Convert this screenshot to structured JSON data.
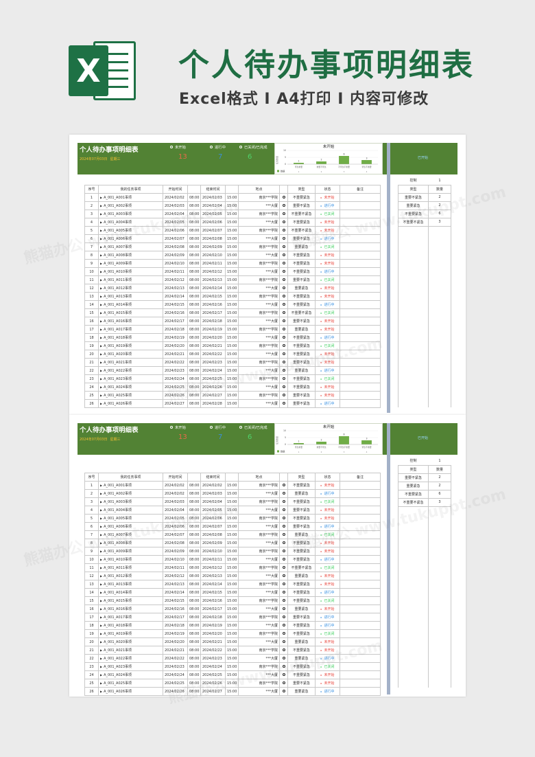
{
  "header": {
    "logo_letter": "X",
    "title": "个人待办事项明细表",
    "subtitle": "Excel格式 I A4打印 I 内容可修改"
  },
  "sheet": {
    "title": "个人待办事项明细表",
    "date": "2024年07月03日",
    "weekday": "星期三",
    "stats": [
      {
        "label": "未开始",
        "value": "13",
        "color": "#e86a4a"
      },
      {
        "label": "进行中",
        "value": "7",
        "color": "#3a8fd9"
      },
      {
        "label": "已关闭/已完成",
        "value": "6",
        "color": "#4fd36b"
      }
    ],
    "right_label": "已开始",
    "columns": [
      "序号",
      "我的任务事项",
      "开始时间",
      "",
      "结束时间",
      "",
      "地点",
      "",
      "类型",
      "状态",
      "备注"
    ]
  },
  "chart_data": {
    "type": "bar",
    "title": "未开始",
    "categories": [
      "紧急重要",
      "重要不紧急",
      "不紧急不重要",
      "紧急不重要"
    ],
    "values": [
      1,
      2,
      6,
      3
    ],
    "ylim": [
      0,
      10
    ],
    "ylabel": "任务数量",
    "y_ticks": [
      "10",
      "5",
      "0"
    ],
    "x_ticks": [
      "1",
      "2",
      "3",
      "4"
    ],
    "legend": "数据",
    "bar_color": "#70ad47"
  },
  "control": {
    "label": "控制",
    "value": "1",
    "headers": [
      "类型",
      "数量"
    ],
    "rows": [
      {
        "type": "重要不紧急",
        "count": "2"
      },
      {
        "type": "重要紧急",
        "count": "2"
      },
      {
        "type": "不重要紧急",
        "count": "6"
      },
      {
        "type": "不重要不紧急",
        "count": "3"
      }
    ]
  },
  "status_colors": {
    "未开始": "#e8453c",
    "进行中": "#2f8be0",
    "已关闭": "#3ccf5c"
  },
  "rows1": [
    {
      "n": "1",
      "t": "A_001_A001事项",
      "sd": "2024/02/02",
      "st": "08:00",
      "ed": "2024/02/03",
      "et": "15:00",
      "p": "南京***学院",
      "ty": "不重要紧急",
      "s": "未开始"
    },
    {
      "n": "2",
      "t": "A_001_A002事项",
      "sd": "2024/02/03",
      "st": "08:00",
      "ed": "2024/02/04",
      "et": "15:00",
      "p": "***大厦",
      "ty": "重要不紧急",
      "s": "进行中"
    },
    {
      "n": "3",
      "t": "A_001_A003事项",
      "sd": "2024/02/04",
      "st": "08:00",
      "ed": "2024/02/05",
      "et": "15:00",
      "p": "南京***学院",
      "ty": "不重要不紧急",
      "s": "已关闭"
    },
    {
      "n": "4",
      "t": "A_001_A004事项",
      "sd": "2024/02/05",
      "st": "08:00",
      "ed": "2024/02/06",
      "et": "15:00",
      "p": "***大厦",
      "ty": "不重要紧急",
      "s": "未开始"
    },
    {
      "n": "5",
      "t": "A_001_A005事项",
      "sd": "2024/02/06",
      "st": "08:00",
      "ed": "2024/02/07",
      "et": "15:00",
      "p": "南京***学院",
      "ty": "不重要不紧急",
      "s": "未开始"
    },
    {
      "n": "6",
      "t": "A_001_A006事项",
      "sd": "2024/02/07",
      "st": "08:00",
      "ed": "2024/02/08",
      "et": "15:00",
      "p": "***大厦",
      "ty": "重要不紧急",
      "s": "进行中"
    },
    {
      "n": "7",
      "t": "A_001_A007事项",
      "sd": "2024/02/08",
      "st": "08:00",
      "ed": "2024/02/09",
      "et": "15:00",
      "p": "南京***学院",
      "ty": "重要紧急",
      "s": "已关闭"
    },
    {
      "n": "8",
      "t": "A_001_A008事项",
      "sd": "2024/02/09",
      "st": "08:00",
      "ed": "2024/02/10",
      "et": "15:00",
      "p": "***大厦",
      "ty": "不重要紧急",
      "s": "未开始"
    },
    {
      "n": "9",
      "t": "A_001_A009事项",
      "sd": "2024/02/10",
      "st": "08:00",
      "ed": "2024/02/11",
      "et": "15:00",
      "p": "南京***学院",
      "ty": "不重要紧急",
      "s": "未开始"
    },
    {
      "n": "10",
      "t": "A_001_A010事项",
      "sd": "2024/02/11",
      "st": "08:00",
      "ed": "2024/02/12",
      "et": "15:00",
      "p": "***大厦",
      "ty": "不重要紧急",
      "s": "进行中"
    },
    {
      "n": "11",
      "t": "A_001_A011事项",
      "sd": "2024/02/12",
      "st": "08:00",
      "ed": "2024/02/13",
      "et": "15:00",
      "p": "南京***学院",
      "ty": "重要不紧急",
      "s": "已关闭"
    },
    {
      "n": "12",
      "t": "A_001_A012事项",
      "sd": "2024/02/13",
      "st": "08:00",
      "ed": "2024/02/14",
      "et": "15:00",
      "p": "***大厦",
      "ty": "重要紧急",
      "s": "未开始"
    },
    {
      "n": "13",
      "t": "A_001_A013事项",
      "sd": "2024/02/14",
      "st": "08:00",
      "ed": "2024/02/15",
      "et": "15:00",
      "p": "南京***学院",
      "ty": "不重要紧急",
      "s": "未开始"
    },
    {
      "n": "14",
      "t": "A_001_A014事项",
      "sd": "2024/02/15",
      "st": "08:00",
      "ed": "2024/02/16",
      "et": "15:00",
      "p": "***大厦",
      "ty": "不重要紧急",
      "s": "进行中"
    },
    {
      "n": "15",
      "t": "A_001_A015事项",
      "sd": "2024/02/16",
      "st": "08:00",
      "ed": "2024/02/17",
      "et": "15:00",
      "p": "南京***学院",
      "ty": "不重要不紧急",
      "s": "已关闭"
    },
    {
      "n": "16",
      "t": "A_001_A016事项",
      "sd": "2024/02/17",
      "st": "08:00",
      "ed": "2024/02/18",
      "et": "15:00",
      "p": "***大厦",
      "ty": "重要不紧急",
      "s": "未开始"
    },
    {
      "n": "17",
      "t": "A_001_A017事项",
      "sd": "2024/02/18",
      "st": "08:00",
      "ed": "2024/02/19",
      "et": "15:00",
      "p": "南京***学院",
      "ty": "重要紧急",
      "s": "未开始"
    },
    {
      "n": "18",
      "t": "A_001_A018事项",
      "sd": "2024/02/19",
      "st": "08:00",
      "ed": "2024/02/20",
      "et": "15:00",
      "p": "***大厦",
      "ty": "不重要紧急",
      "s": "进行中"
    },
    {
      "n": "19",
      "t": "A_001_A019事项",
      "sd": "2024/02/20",
      "st": "08:00",
      "ed": "2024/02/21",
      "et": "15:00",
      "p": "南京***学院",
      "ty": "不重要紧急",
      "s": "已关闭"
    },
    {
      "n": "20",
      "t": "A_001_A020事项",
      "sd": "2024/02/21",
      "st": "08:00",
      "ed": "2024/02/22",
      "et": "15:00",
      "p": "***大厦",
      "ty": "不重要紧急",
      "s": "未开始"
    },
    {
      "n": "21",
      "t": "A_001_A021事项",
      "sd": "2024/02/22",
      "st": "08:00",
      "ed": "2024/02/23",
      "et": "15:00",
      "p": "南京***学院",
      "ty": "重要不紧急",
      "s": "未开始"
    },
    {
      "n": "22",
      "t": "A_001_A022事项",
      "sd": "2024/02/23",
      "st": "08:00",
      "ed": "2024/02/24",
      "et": "15:00",
      "p": "***大厦",
      "ty": "重要紧急",
      "s": "进行中"
    },
    {
      "n": "23",
      "t": "A_001_A023事项",
      "sd": "2024/02/24",
      "st": "08:00",
      "ed": "2024/02/25",
      "et": "15:00",
      "p": "南京***学院",
      "ty": "不重要紧急",
      "s": "已关闭"
    },
    {
      "n": "24",
      "t": "A_001_A024事项",
      "sd": "2024/02/25",
      "st": "08:00",
      "ed": "2024/02/26",
      "et": "15:00",
      "p": "***大厦",
      "ty": "不重要紧急",
      "s": "未开始"
    },
    {
      "n": "25",
      "t": "A_001_A025事项",
      "sd": "2024/02/26",
      "st": "08:00",
      "ed": "2024/02/27",
      "et": "15:00",
      "p": "南京***学院",
      "ty": "重要不紧急",
      "s": "未开始"
    },
    {
      "n": "26",
      "t": "A_001_A026事项",
      "sd": "2024/02/27",
      "st": "08:00",
      "ed": "2024/02/28",
      "et": "15:00",
      "p": "***大厦",
      "ty": "重要不紧急",
      "s": "进行中"
    }
  ],
  "rows2": [
    {
      "n": "1",
      "t": "A_001_A001事项",
      "sd": "2024/02/02",
      "st": "08:00",
      "ed": "2024/02/02",
      "et": "15:00",
      "p": "南京***学院",
      "ty": "不重要紧急",
      "s": "未开始"
    },
    {
      "n": "2",
      "t": "A_001_A002事项",
      "sd": "2024/02/02",
      "st": "08:00",
      "ed": "2024/02/03",
      "et": "15:00",
      "p": "***大厦",
      "ty": "重要紧急",
      "s": "进行中"
    },
    {
      "n": "3",
      "t": "A_001_A003事项",
      "sd": "2024/02/03",
      "st": "08:00",
      "ed": "2024/02/04",
      "et": "15:00",
      "p": "南京***学院",
      "ty": "不重要紧急",
      "s": "已关闭"
    },
    {
      "n": "4",
      "t": "A_001_A004事项",
      "sd": "2024/02/04",
      "st": "08:00",
      "ed": "2024/02/05",
      "et": "15:00",
      "p": "***大厦",
      "ty": "重要不紧急",
      "s": "未开始"
    },
    {
      "n": "5",
      "t": "A_001_A005事项",
      "sd": "2024/02/05",
      "st": "08:00",
      "ed": "2024/02/06",
      "et": "15:00",
      "p": "南京***学院",
      "ty": "不重要紧急",
      "s": "未开始"
    },
    {
      "n": "6",
      "t": "A_001_A006事项",
      "sd": "2024/02/06",
      "st": "08:00",
      "ed": "2024/02/07",
      "et": "15:00",
      "p": "***大厦",
      "ty": "重要不紧急",
      "s": "进行中"
    },
    {
      "n": "7",
      "t": "A_001_A007事项",
      "sd": "2024/02/07",
      "st": "08:00",
      "ed": "2024/02/08",
      "et": "15:00",
      "p": "南京***学院",
      "ty": "重要紧急",
      "s": "已关闭"
    },
    {
      "n": "8",
      "t": "A_001_A008事项",
      "sd": "2024/02/08",
      "st": "08:00",
      "ed": "2024/02/09",
      "et": "15:00",
      "p": "***大厦",
      "ty": "不重要紧急",
      "s": "未开始"
    },
    {
      "n": "9",
      "t": "A_001_A009事项",
      "sd": "2024/02/09",
      "st": "08:00",
      "ed": "2024/02/10",
      "et": "15:00",
      "p": "南京***学院",
      "ty": "不重要紧急",
      "s": "未开始"
    },
    {
      "n": "10",
      "t": "A_001_A010事项",
      "sd": "2024/02/10",
      "st": "08:00",
      "ed": "2024/02/11",
      "et": "15:00",
      "p": "***大厦",
      "ty": "不重要紧急",
      "s": "进行中"
    },
    {
      "n": "11",
      "t": "A_001_A011事项",
      "sd": "2024/02/11",
      "st": "08:00",
      "ed": "2024/02/12",
      "et": "15:00",
      "p": "南京***学院",
      "ty": "不重要不紧急",
      "s": "已关闭"
    },
    {
      "n": "12",
      "t": "A_001_A012事项",
      "sd": "2024/02/12",
      "st": "08:00",
      "ed": "2024/02/13",
      "et": "15:00",
      "p": "***大厦",
      "ty": "重要紧急",
      "s": "未开始"
    },
    {
      "n": "13",
      "t": "A_001_A013事项",
      "sd": "2024/02/13",
      "st": "08:00",
      "ed": "2024/02/14",
      "et": "15:00",
      "p": "南京***学院",
      "ty": "不重要紧急",
      "s": "未开始"
    },
    {
      "n": "14",
      "t": "A_001_A014事项",
      "sd": "2024/02/14",
      "st": "08:00",
      "ed": "2024/02/15",
      "et": "15:00",
      "p": "***大厦",
      "ty": "不重要紧急",
      "s": "进行中"
    },
    {
      "n": "15",
      "t": "A_001_A015事项",
      "sd": "2024/02/15",
      "st": "08:00",
      "ed": "2024/02/16",
      "et": "15:00",
      "p": "南京***学院",
      "ty": "不重要紧急",
      "s": "已关闭"
    },
    {
      "n": "16",
      "t": "A_001_A016事项",
      "sd": "2024/02/16",
      "st": "08:00",
      "ed": "2024/02/17",
      "et": "15:00",
      "p": "***大厦",
      "ty": "重要紧急",
      "s": "未开始"
    },
    {
      "n": "17",
      "t": "A_001_A017事项",
      "sd": "2024/02/17",
      "st": "08:00",
      "ed": "2024/02/18",
      "et": "15:00",
      "p": "南京***学院",
      "ty": "重要不紧急",
      "s": "进行中"
    },
    {
      "n": "18",
      "t": "A_001_A018事项",
      "sd": "2024/02/18",
      "st": "08:00",
      "ed": "2024/02/19",
      "et": "15:00",
      "p": "***大厦",
      "ty": "不重要紧急",
      "s": "进行中"
    },
    {
      "n": "19",
      "t": "A_001_A019事项",
      "sd": "2024/02/19",
      "st": "08:00",
      "ed": "2024/02/20",
      "et": "15:00",
      "p": "南京***学院",
      "ty": "不重要紧急",
      "s": "已关闭"
    },
    {
      "n": "20",
      "t": "A_001_A020事项",
      "sd": "2024/02/20",
      "st": "08:00",
      "ed": "2024/02/21",
      "et": "15:00",
      "p": "***大厦",
      "ty": "重要紧急",
      "s": "未开始"
    },
    {
      "n": "21",
      "t": "A_001_A021事项",
      "sd": "2024/02/21",
      "st": "08:00",
      "ed": "2024/02/22",
      "et": "15:00",
      "p": "南京***学院",
      "ty": "不重要紧急",
      "s": "未开始"
    },
    {
      "n": "22",
      "t": "A_001_A022事项",
      "sd": "2024/02/22",
      "st": "08:00",
      "ed": "2024/02/23",
      "et": "15:00",
      "p": "***大厦",
      "ty": "重要紧急",
      "s": "进行中"
    },
    {
      "n": "23",
      "t": "A_001_A023事项",
      "sd": "2024/02/23",
      "st": "08:00",
      "ed": "2024/02/24",
      "et": "15:00",
      "p": "南京***学院",
      "ty": "不重要紧急",
      "s": "已关闭"
    },
    {
      "n": "24",
      "t": "A_001_A024事项",
      "sd": "2024/02/24",
      "st": "08:00",
      "ed": "2024/02/25",
      "et": "15:00",
      "p": "***大厦",
      "ty": "不重要紧急",
      "s": "未开始"
    },
    {
      "n": "25",
      "t": "A_001_A025事项",
      "sd": "2024/02/25",
      "st": "08:00",
      "ed": "2024/02/26",
      "et": "15:00",
      "p": "南京***学院",
      "ty": "重要不紧急",
      "s": "未开始"
    },
    {
      "n": "26",
      "t": "A_001_A026事项",
      "sd": "2024/02/26",
      "st": "08:00",
      "ed": "2024/02/27",
      "et": "15:00",
      "p": "***大厦",
      "ty": "重要紧急",
      "s": "进行中"
    }
  ],
  "watermark": "熊猫办公 www.tukuppt.com"
}
